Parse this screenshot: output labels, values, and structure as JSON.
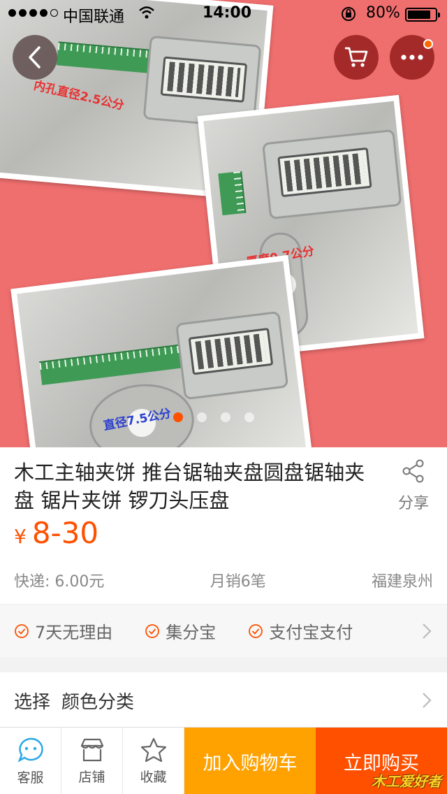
{
  "status_bar": {
    "carrier": "中国联通",
    "time": "14:00",
    "battery": "80%"
  },
  "gallery": {
    "captions": [
      "内孔直径2.5公分",
      "厚度0.7公分",
      "直径7.5公分"
    ],
    "page_count": 4,
    "active_index": 0
  },
  "nav": {
    "back_icon": "chevron-left-icon",
    "cart_icon": "cart-icon",
    "more_icon": "ellipsis-icon"
  },
  "product": {
    "title": "木工主轴夹饼 推台锯轴夹盘圆盘锯轴夹盘  锯片夹饼 锣刀头压盘",
    "currency": "¥",
    "price": "8-30",
    "shipping": "快递: 6.00元",
    "monthly_sales": "月销6笔",
    "location": "福建泉州",
    "share_label": "分享"
  },
  "services": [
    "7天无理由",
    "集分宝",
    "支付宝支付"
  ],
  "select": {
    "label": "选择",
    "value": "颜色分类"
  },
  "bottom_bar": {
    "service_label": "客服",
    "store_label": "店铺",
    "favorite_label": "收藏",
    "add_cart_label": "加入购物车",
    "buy_now_label": "立即购买",
    "watermark": "木工爱好者"
  },
  "colors": {
    "accent": "#ff5000",
    "add_cart": "#ffa200",
    "hero_bg": "#ef6e6e"
  }
}
